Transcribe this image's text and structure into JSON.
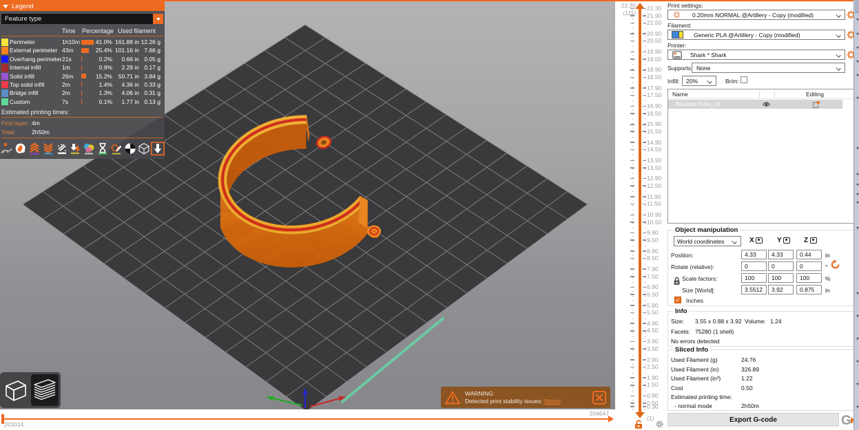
{
  "accent_color": "#ED6B21",
  "legend": {
    "title": "Legend",
    "feature_type_value": "Feature type",
    "columns": [
      "Time",
      "Percentage",
      "Used filament"
    ],
    "rows": [
      {
        "color": "#f5e23d",
        "label": "Perimeter",
        "time": "1h10m",
        "pct": "41.0%",
        "pct_val": 41.0,
        "used_in": "161.88 in",
        "used_g": "12.26 g"
      },
      {
        "color": "#f5821e",
        "label": "External perimeter",
        "time": "43m",
        "pct": "25.4%",
        "pct_val": 25.4,
        "used_in": "101.16 in",
        "used_g": "7.66 g"
      },
      {
        "color": "#1a1aff",
        "label": "Overhang perimeter",
        "time": "21s",
        "pct": "0.2%",
        "pct_val": 0.2,
        "used_in": "0.66 in",
        "used_g": "0.05 g"
      },
      {
        "color": "#a62b2b",
        "label": "Internal infill",
        "time": "1m",
        "pct": "0.9%",
        "pct_val": 0.9,
        "used_in": "2.29 in",
        "used_g": "0.17 g"
      },
      {
        "color": "#9b52d0",
        "label": "Solid infill",
        "time": "26m",
        "pct": "15.2%",
        "pct_val": 15.2,
        "used_in": "50.71 in",
        "used_g": "3.84 g"
      },
      {
        "color": "#ee3a48",
        "label": "Top solid infill",
        "time": "2m",
        "pct": "1.4%",
        "pct_val": 1.4,
        "used_in": "4.36 in",
        "used_g": "0.33 g"
      },
      {
        "color": "#5a8fc8",
        "label": "Bridge infill",
        "time": "2m",
        "pct": "1.3%",
        "pct_val": 1.3,
        "used_in": "4.06 in",
        "used_g": "0.31 g"
      },
      {
        "color": "#5ed99c",
        "label": "Custom",
        "time": "7s",
        "pct": "0.1%",
        "pct_val": 0.1,
        "used_in": "1.77 in",
        "used_g": "0.13 g"
      }
    ],
    "times_title": "Estimated printing times:",
    "first_layer_label": "First layer:",
    "first_layer_value": "4m",
    "total_label": "Total:",
    "total_value": "2h50m",
    "toolbar_icons": [
      "travels",
      "retractions",
      "deretractions",
      "unretractions",
      "seams",
      "tool-changes",
      "color-changes",
      "pause-prints",
      "custom-gcodes",
      "shells",
      "tool-marker",
      "travel-paths"
    ]
  },
  "viewport": {
    "view_buttons": [
      "3d-editor-view",
      "preview-view"
    ],
    "active_view": "preview-view",
    "warning": {
      "title": "WARNING:",
      "message": "Detected print stability issues:",
      "link": "[More]"
    },
    "move_slider": {
      "left_value": "203014",
      "right_value": "204647"
    }
  },
  "layer_slider": {
    "current_height": "22.30",
    "current_layer": "(111)",
    "bottom_layer": "(1)",
    "max_value": 22.3,
    "tick_labels": [
      "22.30",
      "21.90",
      "21.50",
      "20.90",
      "20.50",
      "19.90",
      "19.50",
      "18.90",
      "18.50",
      "17.90",
      "17.50",
      "16.90",
      "16.50",
      "15.90",
      "15.50",
      "14.90",
      "14.50",
      "13.90",
      "13.50",
      "12.90",
      "12.50",
      "11.90",
      "11.50",
      "10.90",
      "10.50",
      "9.90",
      "9.50",
      "8.90",
      "8.50",
      "7.90",
      "7.50",
      "6.90",
      "6.50",
      "5.90",
      "5.50",
      "4.90",
      "4.50",
      "3.90",
      "3.50",
      "2.90",
      "2.50",
      "1.90",
      "1.50",
      "0.90",
      "0.50",
      "0.30"
    ]
  },
  "sidebar": {
    "print_settings_label": "Print settings:",
    "print_settings_value": "0.20mm NORMAL @Artillery - Copy (modified)",
    "filament_label": "Filament:",
    "filament_value": "Generic PLA @Artillery - Copy (modified)",
    "printer_label": "Printer:",
    "printer_value": "Shark * Shark",
    "supports_label": "Supports:",
    "supports_value": "None",
    "infill_label": "Infill:",
    "infill_value": "20%",
    "brim_label": "Brim:",
    "brim_checked": false,
    "object_list": {
      "name_column": "Name",
      "editing_column": "Editing",
      "rows": [
        {
          "name": "BourdonTube_01"
        }
      ]
    },
    "object_manipulation": {
      "title": "Object manipulation",
      "coordinates_value": "World coordinates",
      "axis_headers": [
        "X",
        "Y",
        "Z"
      ],
      "rows": [
        {
          "label": "Position:",
          "x": "4.33",
          "y": "4.33",
          "z": "0.44",
          "unit": "in"
        },
        {
          "label": "Rotate (relative):",
          "x": "0",
          "y": "0",
          "z": "0",
          "unit": "°"
        },
        {
          "label": "Scale factors:",
          "x": "100",
          "y": "100",
          "z": "100",
          "unit": "%"
        },
        {
          "label": "Size [World]:",
          "x": "3.5512",
          "y": "3.92",
          "z": "0.875",
          "unit": "in"
        }
      ],
      "inches_label": "Inches",
      "inches_checked": true
    },
    "info": {
      "title": "Info",
      "size_label": "Size:",
      "size_value": "3.55 x 0.88 x 3.92",
      "volume_label": "Volume:",
      "volume_value": "1.24",
      "facets_label": "Facets:",
      "facets_value": "75280 (1 shell)",
      "errors_value": "No errors detected"
    },
    "sliced_info": {
      "title": "Sliced Info",
      "rows": [
        {
          "label": "Used Filament (g)",
          "value": "24.76"
        },
        {
          "label": "Used Filament (in)",
          "value": "326.89"
        },
        {
          "label": "Used Filament (in³)",
          "value": "1.22"
        },
        {
          "label": "Cost",
          "value": "0.50"
        }
      ],
      "time_label": "Estimated printing time:",
      "mode_label": "- normal mode",
      "mode_value": "2h50m"
    },
    "export_button_label": "Export G-code"
  }
}
